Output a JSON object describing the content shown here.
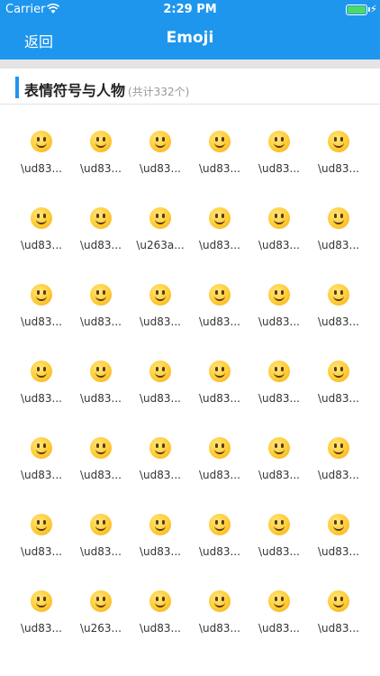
{
  "status_bar": {
    "carrier": "Carrier",
    "time": "2:29 PM",
    "battery_color": "#4cd964"
  },
  "nav": {
    "back_label": "返回",
    "title": "Emoji",
    "color": "#1e96ee"
  },
  "section": {
    "title": "表情符号与人物",
    "count_label": "(共计332个)",
    "accent_color": "#1e96ee"
  },
  "emoji_items": [
    {
      "icon": "grinning-face-icon",
      "label": "\\ud83..."
    },
    {
      "icon": "grinning-face-big-eyes-icon",
      "label": "\\ud83..."
    },
    {
      "icon": "grinning-face-smiling-eyes-icon",
      "label": "\\ud83..."
    },
    {
      "icon": "beaming-face-icon",
      "label": "\\ud83..."
    },
    {
      "icon": "grinning-squinting-face-icon",
      "label": "\\ud83..."
    },
    {
      "icon": "grinning-face-sweat-icon",
      "label": "\\ud83..."
    },
    {
      "icon": "face-tears-of-joy-icon",
      "label": "\\ud83..."
    },
    {
      "icon": "rolling-on-floor-laughing-icon",
      "label": "\\ud83..."
    },
    {
      "icon": "smiling-face-icon",
      "label": "\\u263a..."
    },
    {
      "icon": "smiling-face-smiling-eyes-icon",
      "label": "\\ud83..."
    },
    {
      "icon": "smiling-face-halo-icon",
      "label": "\\ud83..."
    },
    {
      "icon": "slightly-smiling-face-icon",
      "label": "\\ud83..."
    },
    {
      "icon": "upside-down-face-icon",
      "label": "\\ud83..."
    },
    {
      "icon": "winking-face-icon",
      "label": "\\ud83..."
    },
    {
      "icon": "relieved-face-icon",
      "label": "\\ud83..."
    },
    {
      "icon": "heart-eyes-face-icon",
      "label": "\\ud83..."
    },
    {
      "icon": "face-blowing-kiss-icon",
      "label": "\\ud83..."
    },
    {
      "icon": "kissing-face-icon",
      "label": "\\ud83..."
    },
    {
      "icon": "kissing-face-smiling-eyes-icon",
      "label": "\\ud83..."
    },
    {
      "icon": "kissing-face-closed-eyes-icon",
      "label": "\\ud83..."
    },
    {
      "icon": "face-savoring-food-icon",
      "label": "\\ud83..."
    },
    {
      "icon": "face-with-tongue-icon",
      "label": "\\ud83..."
    },
    {
      "icon": "squinting-face-tongue-icon",
      "label": "\\ud83..."
    },
    {
      "icon": "winking-face-tongue-icon",
      "label": "\\ud83..."
    },
    {
      "icon": "zany-face-icon",
      "label": "\\ud83..."
    },
    {
      "icon": "face-raised-eyebrow-icon",
      "label": "\\ud83..."
    },
    {
      "icon": "face-with-monocle-icon",
      "label": "\\ud83..."
    },
    {
      "icon": "nerd-face-icon",
      "label": "\\ud83..."
    },
    {
      "icon": "smiling-face-sunglasses-icon",
      "label": "\\ud83..."
    },
    {
      "icon": "star-struck-icon",
      "label": "\\ud83..."
    },
    {
      "icon": "smirking-face-icon",
      "label": "\\ud83..."
    },
    {
      "icon": "unamused-face-icon",
      "label": "\\ud83..."
    },
    {
      "icon": "disappointed-face-icon",
      "label": "\\ud83..."
    },
    {
      "icon": "pensive-face-icon",
      "label": "\\ud83..."
    },
    {
      "icon": "worried-face-icon",
      "label": "\\ud83..."
    },
    {
      "icon": "confused-face-icon",
      "label": "\\ud83..."
    },
    {
      "icon": "slightly-frowning-face-icon",
      "label": "\\ud83..."
    },
    {
      "icon": "frowning-face-icon",
      "label": "\\u263..."
    },
    {
      "icon": "persevering-face-icon",
      "label": "\\ud83..."
    },
    {
      "icon": "confounded-face-icon",
      "label": "\\ud83..."
    },
    {
      "icon": "tired-face-icon",
      "label": "\\ud83..."
    },
    {
      "icon": "weary-face-icon",
      "label": "\\ud83..."
    }
  ]
}
